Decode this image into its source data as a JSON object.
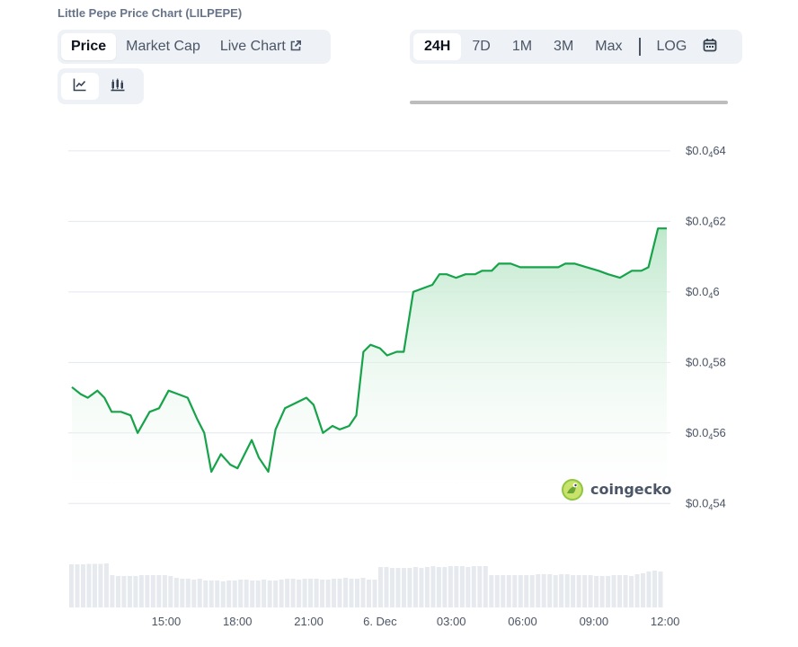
{
  "header": {
    "title": "Little Pepe Price Chart (LILPEPE)"
  },
  "chart_tabs": [
    {
      "label": "Price",
      "active": true
    },
    {
      "label": "Market Cap",
      "active": false
    },
    {
      "label": "Live Chart",
      "active": false,
      "icon": "external-link-icon"
    }
  ],
  "range_tabs": [
    {
      "label": "24H",
      "active": true
    },
    {
      "label": "7D",
      "active": false
    },
    {
      "label": "1M",
      "active": false
    },
    {
      "label": "3M",
      "active": false
    },
    {
      "label": "Max",
      "active": false
    }
  ],
  "log_label": "LOG",
  "calendar_icon": "calendar-icon",
  "style_buttons": [
    {
      "icon": "line-chart-icon",
      "active": true
    },
    {
      "icon": "candlestick-chart-icon",
      "active": false
    }
  ],
  "watermark": {
    "text": "coingecko",
    "icon": "coingecko-logo-icon"
  },
  "colors": {
    "line": "#16a34a",
    "fill_top": "#bfe8cc",
    "grid": "#e3e8ef",
    "volume": "#e6e9ee"
  },
  "chart_data": {
    "type": "area",
    "title": "",
    "xlabel": "",
    "ylabel": "",
    "ylim": [
      5.36e-06,
      6.42e-06
    ],
    "y_ticks": [
      {
        "value": 5.4e-06,
        "main": "$0.0",
        "sub": "4",
        "rest": "54"
      },
      {
        "value": 5.6e-06,
        "main": "$0.0",
        "sub": "4",
        "rest": "56"
      },
      {
        "value": 5.8e-06,
        "main": "$0.0",
        "sub": "4",
        "rest": "58"
      },
      {
        "value": 6e-06,
        "main": "$0.0",
        "sub": "4",
        "rest": "6"
      },
      {
        "value": 6.2e-06,
        "main": "$0.0",
        "sub": "4",
        "rest": "62"
      },
      {
        "value": 6.4e-06,
        "main": "$0.0",
        "sub": "4",
        "rest": "64"
      }
    ],
    "x_ticks": [
      {
        "label": "15:00",
        "hour": 3
      },
      {
        "label": "18:00",
        "hour": 6
      },
      {
        "label": "21:00",
        "hour": 9
      },
      {
        "label": "6. Dec",
        "hour": 12
      },
      {
        "label": "03:00",
        "hour": 15
      },
      {
        "label": "06:00",
        "hour": 18
      },
      {
        "label": "09:00",
        "hour": 21
      },
      {
        "label": "12:00",
        "hour": 24
      }
    ],
    "x_range_hours": [
      -0.97,
      24.07
    ],
    "series": [
      {
        "x": [
          -0.97,
          -0.6,
          -0.3,
          0.1,
          0.4,
          0.7,
          1.1,
          1.5,
          1.8,
          2.3,
          2.7,
          3.1,
          3.5,
          3.9,
          4.3,
          4.6,
          4.9,
          5.3,
          5.7,
          6.0,
          6.3,
          6.6,
          6.9,
          7.3,
          7.6,
          8.0,
          8.3,
          8.6,
          8.9,
          9.2,
          9.6,
          10.0,
          10.3,
          10.7,
          11.0,
          11.3,
          11.6,
          12.0,
          12.3,
          12.7,
          13.0,
          13.4,
          13.8,
          14.2,
          14.5,
          14.8,
          15.2,
          15.6,
          16.0,
          16.3,
          16.7,
          17.0,
          17.5,
          17.9,
          18.3,
          18.7,
          19.1,
          19.5,
          19.8,
          20.2,
          20.7,
          21.2,
          21.6,
          22.1,
          22.6,
          23.0,
          23.3,
          23.7,
          24.07
        ],
        "y": [
          5.73e-06,
          5.71e-06,
          5.7e-06,
          5.72e-06,
          5.7e-06,
          5.66e-06,
          5.66e-06,
          5.65e-06,
          5.6e-06,
          5.66e-06,
          5.67e-06,
          5.72e-06,
          5.71e-06,
          5.7e-06,
          5.64e-06,
          5.6e-06,
          5.49e-06,
          5.54e-06,
          5.51e-06,
          5.5e-06,
          5.54e-06,
          5.58e-06,
          5.53e-06,
          5.49e-06,
          5.61e-06,
          5.67e-06,
          5.68e-06,
          5.69e-06,
          5.7e-06,
          5.68e-06,
          5.6e-06,
          5.62e-06,
          5.61e-06,
          5.62e-06,
          5.65e-06,
          5.83e-06,
          5.85e-06,
          5.84e-06,
          5.82e-06,
          5.83e-06,
          5.83e-06,
          6e-06,
          6.01e-06,
          6.02e-06,
          6.05e-06,
          6.05e-06,
          6.04e-06,
          6.05e-06,
          6.05e-06,
          6.06e-06,
          6.06e-06,
          6.08e-06,
          6.08e-06,
          6.07e-06,
          6.07e-06,
          6.07e-06,
          6.07e-06,
          6.07e-06,
          6.08e-06,
          6.08e-06,
          6.07e-06,
          6.06e-06,
          6.05e-06,
          6.04e-06,
          6.06e-06,
          6.06e-06,
          6.07e-06,
          6.18e-06,
          6.18e-06
        ]
      }
    ],
    "volume_relative": [
      0.96,
      0.96,
      0.96,
      0.97,
      0.97,
      0.97,
      0.98,
      0.72,
      0.7,
      0.7,
      0.7,
      0.7,
      0.72,
      0.72,
      0.72,
      0.72,
      0.72,
      0.7,
      0.66,
      0.64,
      0.64,
      0.62,
      0.64,
      0.6,
      0.6,
      0.6,
      0.58,
      0.6,
      0.6,
      0.62,
      0.62,
      0.6,
      0.6,
      0.62,
      0.6,
      0.6,
      0.62,
      0.64,
      0.64,
      0.62,
      0.64,
      0.64,
      0.64,
      0.62,
      0.62,
      0.64,
      0.64,
      0.66,
      0.64,
      0.64,
      0.66,
      0.62,
      0.62,
      0.9,
      0.9,
      0.88,
      0.88,
      0.88,
      0.88,
      0.9,
      0.88,
      0.9,
      0.92,
      0.9,
      0.9,
      0.92,
      0.92,
      0.92,
      0.9,
      0.92,
      0.92,
      0.92,
      0.72,
      0.72,
      0.72,
      0.72,
      0.72,
      0.72,
      0.72,
      0.72,
      0.74,
      0.74,
      0.74,
      0.72,
      0.74,
      0.74,
      0.72,
      0.72,
      0.72,
      0.72,
      0.7,
      0.7,
      0.7,
      0.72,
      0.72,
      0.72,
      0.7,
      0.74,
      0.76,
      0.8,
      0.82,
      0.8
    ]
  }
}
